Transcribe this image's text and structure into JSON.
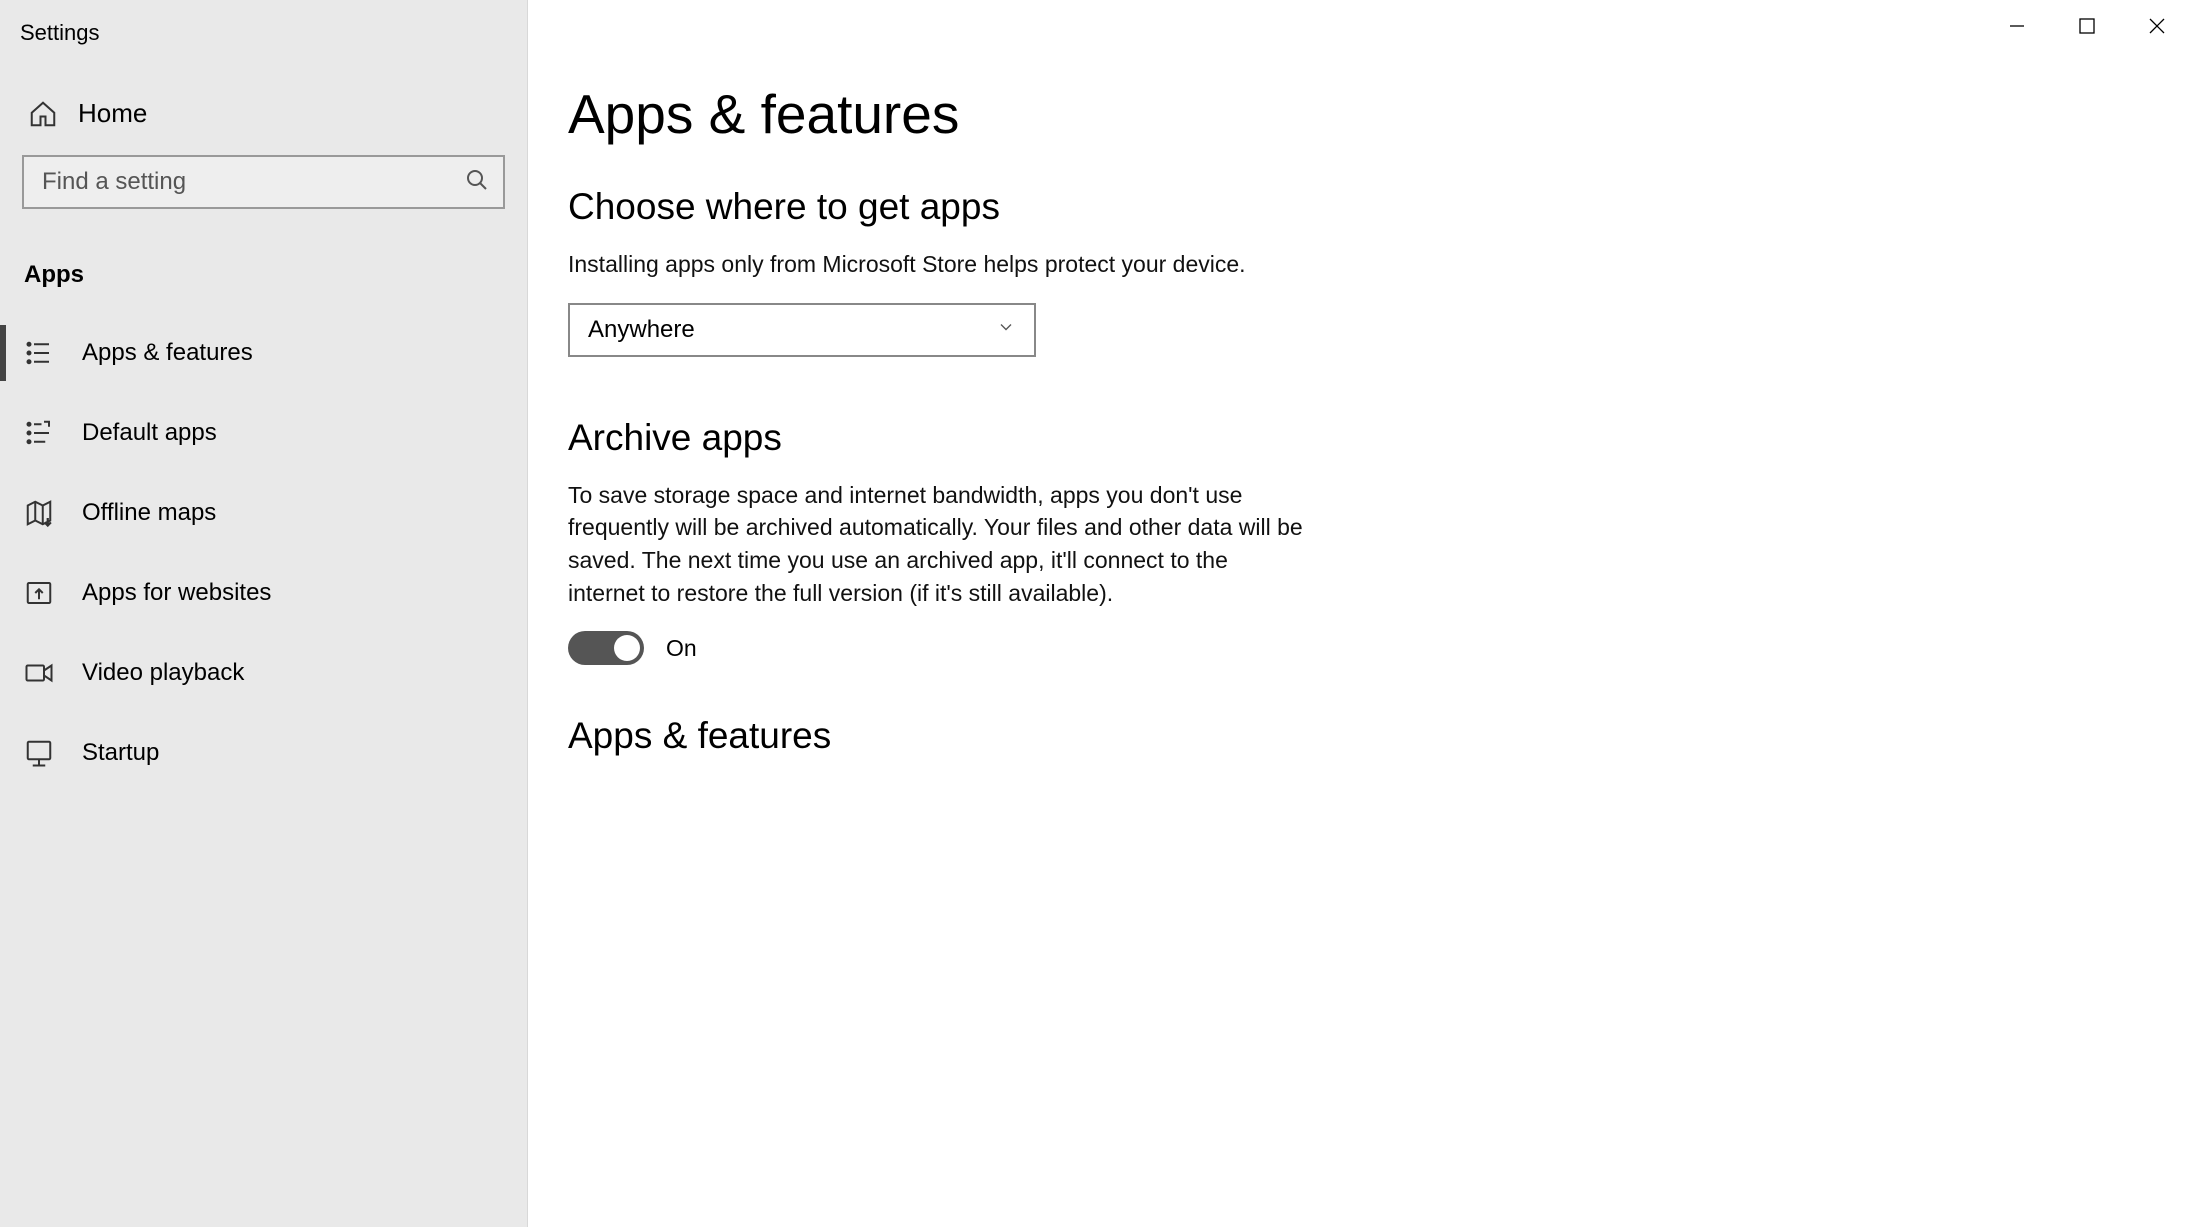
{
  "window": {
    "title": "Settings"
  },
  "sidebar": {
    "home": "Home",
    "search_placeholder": "Find a setting",
    "category": "Apps",
    "items": [
      {
        "label": "Apps & features",
        "active": true
      },
      {
        "label": "Default apps"
      },
      {
        "label": "Offline maps"
      },
      {
        "label": "Apps for websites"
      },
      {
        "label": "Video playback"
      },
      {
        "label": "Startup"
      }
    ]
  },
  "main": {
    "page_title": "Apps & features",
    "section_choose": {
      "title": "Choose where to get apps",
      "desc": "Installing apps only from Microsoft Store helps protect your device.",
      "dropdown_value": "Anywhere"
    },
    "section_archive": {
      "title": "Archive apps",
      "desc": "To save storage space and internet bandwidth, apps you don't use frequently will be archived automatically. Your files and other data will be saved. The next time you use an archived app, it'll connect to the internet to restore the full version (if it's still available).",
      "toggle_state": "On"
    },
    "section_apps_features": {
      "title": "Apps & features"
    }
  }
}
